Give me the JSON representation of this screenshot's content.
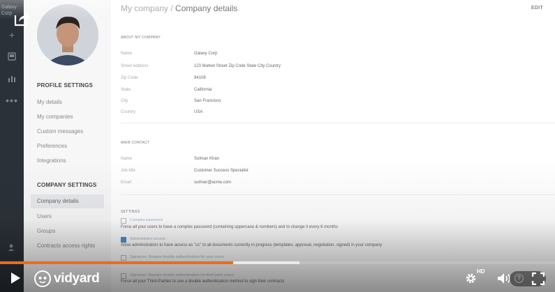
{
  "rail": {
    "brand": "Galaxy Corp",
    "icons": [
      "plus-icon",
      "inbox-icon",
      "chart-icon",
      "more-icon",
      "add-user-icon",
      "help-icon"
    ]
  },
  "sidebar": {
    "profile_heading": "PROFILE SETTINGS",
    "profile_items": [
      "My details",
      "My companies",
      "Custom messages",
      "Preferences",
      "Integrations"
    ],
    "company_heading": "COMPANY SETTINGS",
    "company_items": [
      "Company details",
      "Users",
      "Groups",
      "Contracts access rights"
    ]
  },
  "header": {
    "breadcrumb_parent": "My company",
    "breadcrumb_sep": " / ",
    "breadcrumb_current": "Company details",
    "edit_label": "EDIT"
  },
  "about": {
    "heading": "ABOUT MY COMPANY",
    "fields": [
      {
        "label": "Name",
        "value": "Galaxy Corp"
      },
      {
        "label": "Street Address",
        "value": "123 Market Street Zip Code State City Country"
      },
      {
        "label": "Zip Code",
        "value": "94108"
      },
      {
        "label": "State",
        "value": "California"
      },
      {
        "label": "City",
        "value": "San Francisco"
      },
      {
        "label": "Country",
        "value": "USA"
      }
    ]
  },
  "contact": {
    "heading": "MAIN CONTACT",
    "fields": [
      {
        "label": "Name",
        "value": "Sulman Khan"
      },
      {
        "label": "Job title",
        "value": "Customer Success Specialist"
      },
      {
        "label": "Email",
        "value": "sulman@acme.com"
      }
    ]
  },
  "settings": {
    "heading": "SETTINGS",
    "options": [
      {
        "label": "Complex password",
        "checked": false,
        "desc": "Force all your users to have a complex password (containing uppercase & numbers) and to change it every 6 months"
      },
      {
        "label": "Administrator access",
        "checked": true,
        "desc": "Allow administrators to have access as \"cc\" to all documents currently in progress (templates, approval, negotiation, signed) in your company"
      },
      {
        "label": "Signature: Require double authentication for your users",
        "checked": false,
        "desc": ""
      },
      {
        "label": "Signature: Require double authentication for third party users",
        "checked": false,
        "desc": "Force all your Third-Parties to use a double authentication method to sign their contracts"
      }
    ]
  },
  "player": {
    "logo_text": "vidyard",
    "hd_label": "HD",
    "progress_played": 0.42,
    "progress_buffered": 0.54,
    "accent": "#f06a16"
  }
}
